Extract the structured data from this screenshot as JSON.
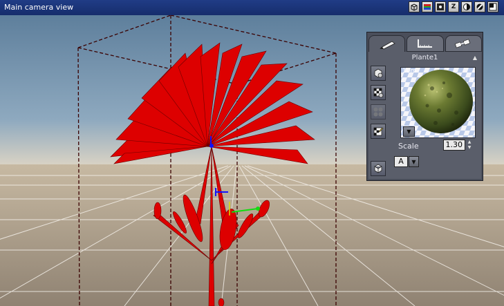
{
  "window": {
    "title": "Main camera view",
    "toolbar_icons": [
      "cube-view-icon",
      "color-bars-icon",
      "dot-icon",
      "z-axis-icon",
      "render-mode-icon",
      "shading-icon",
      "layout-icon"
    ],
    "z_label": "Z"
  },
  "panel": {
    "tabs": [
      "brush-tab",
      "ruler-tab",
      "link-tab"
    ],
    "object_name": "Plante1",
    "preview_label": "10m",
    "scale_label": "Scale",
    "scale_value": "1.30",
    "letter_value": "A"
  },
  "colors": {
    "plant": "#dd0000",
    "sky": "#6e8fad",
    "ground": "#a39583",
    "grid": "#ffffff",
    "bbox": "#2a0000",
    "axis_x": "#11dd11",
    "axis_y": "#1111ff"
  }
}
